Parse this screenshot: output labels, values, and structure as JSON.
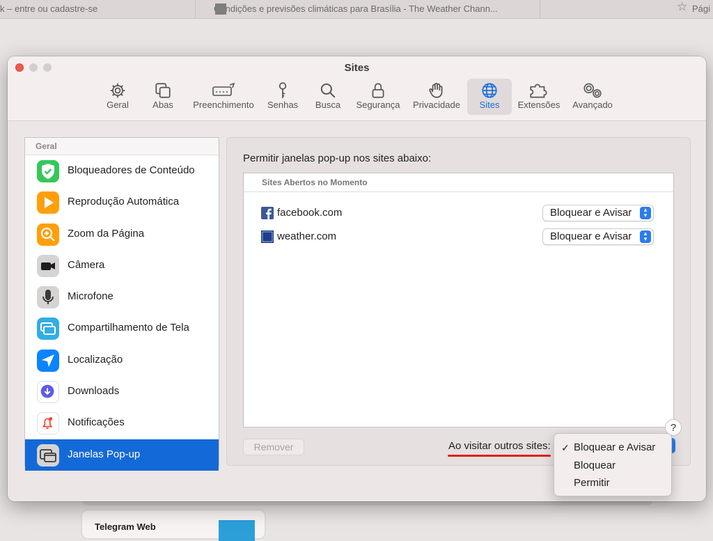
{
  "browser_tabs": [
    {
      "label": "k – entre ou cadastre-se"
    },
    {
      "label": "Condições e previsões climáticas para Brasília - The Weather Chann..."
    },
    {
      "label": "Pági"
    }
  ],
  "window": {
    "title": "Sites"
  },
  "toolbar": {
    "items": [
      {
        "label": "Geral",
        "icon": "gear-icon"
      },
      {
        "label": "Abas",
        "icon": "tabs-icon"
      },
      {
        "label": "Preenchimento",
        "icon": "autofill-icon"
      },
      {
        "label": "Senhas",
        "icon": "key-icon"
      },
      {
        "label": "Busca",
        "icon": "search-icon"
      },
      {
        "label": "Segurança",
        "icon": "lock-icon"
      },
      {
        "label": "Privacidade",
        "icon": "hand-icon"
      },
      {
        "label": "Sites",
        "icon": "globe-icon",
        "active": true
      },
      {
        "label": "Extensões",
        "icon": "puzzle-icon"
      },
      {
        "label": "Avançado",
        "icon": "gears-icon"
      }
    ]
  },
  "sidebar": {
    "section": "Geral",
    "items": [
      {
        "label": "Bloqueadores de Conteúdo",
        "icon": "shield-check-icon",
        "color": "#34c759"
      },
      {
        "label": "Reprodução Automática",
        "icon": "play-icon",
        "color": "#ff9f0a"
      },
      {
        "label": "Zoom da Página",
        "icon": "zoom-icon",
        "color": "#ff9f0a"
      },
      {
        "label": "Câmera",
        "icon": "camera-icon",
        "color": "#8e8e93"
      },
      {
        "label": "Microfone",
        "icon": "microphone-icon",
        "color": "#8e8e93"
      },
      {
        "label": "Compartilhamento de Tela",
        "icon": "screen-share-icon",
        "color": "#32ade6"
      },
      {
        "label": "Localização",
        "icon": "location-icon",
        "color": "#0a84ff"
      },
      {
        "label": "Downloads",
        "icon": "download-icon",
        "color": "#5e5ce6"
      },
      {
        "label": "Notificações",
        "icon": "bell-icon",
        "color": "#ff3b30"
      },
      {
        "label": "Janelas Pop-up",
        "icon": "popup-window-icon",
        "color": "#8e8e93",
        "selected": true
      }
    ]
  },
  "main": {
    "prompt": "Permitir janelas pop-up nos sites abaixo:",
    "table_header": "Sites Abertos no Momento",
    "rows": [
      {
        "site": "facebook.com",
        "setting": "Bloquear e Avisar"
      },
      {
        "site": "weather.com",
        "setting": "Bloquear e Avisar"
      }
    ],
    "remove_label": "Remover",
    "visit_label": "Ao visitar outros sites:",
    "help_label": "?"
  },
  "dropdown": {
    "options": [
      {
        "label": "Bloquear e Avisar",
        "checked": true
      },
      {
        "label": "Bloquear",
        "checked": false
      },
      {
        "label": "Permitir",
        "checked": false
      }
    ],
    "check_mark": "✓"
  },
  "background": {
    "card_title": "Telegram Web"
  },
  "colors": {
    "accent": "#1469d9",
    "underline": "#e0201b"
  }
}
